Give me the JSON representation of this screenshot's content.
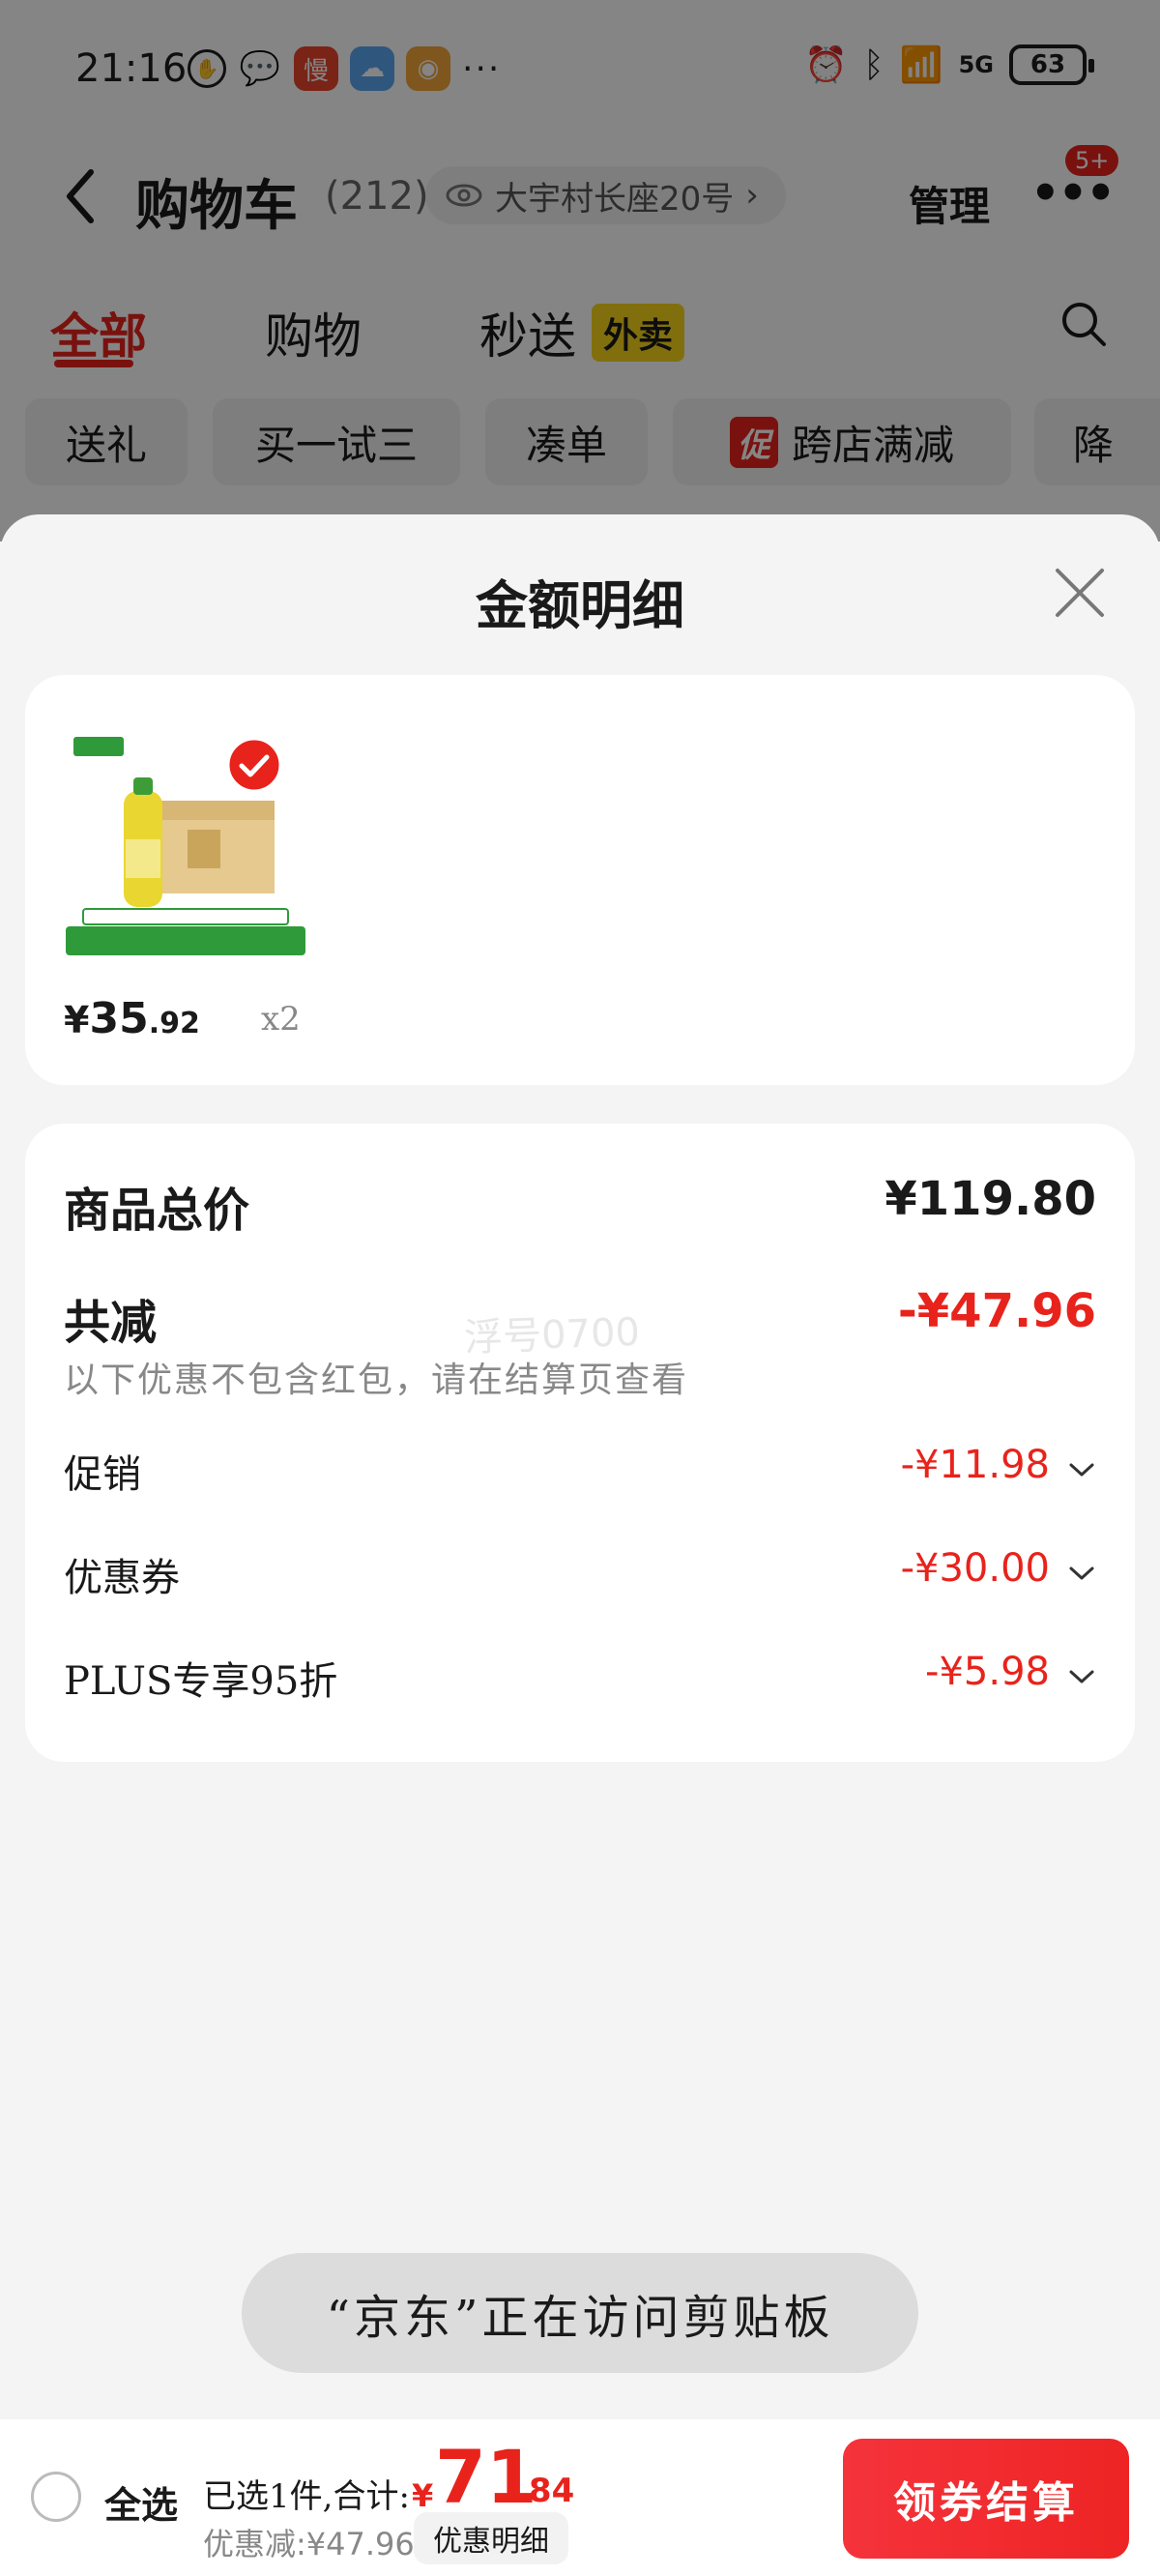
{
  "status_bar": {
    "time": "21:16",
    "left_icons": [
      "hand-icon",
      "wechat-icon",
      "slow-app-icon",
      "weather-icon",
      "orange-app-icon"
    ],
    "slow_app_glyph": "慢",
    "more": "···",
    "network": "5G",
    "battery": "63"
  },
  "cart_header": {
    "title": "购物车",
    "count": "(212)",
    "address": "大宇村长座20号",
    "address_chevron": "›",
    "manage": "管理",
    "more_badge": "5+"
  },
  "tabs": {
    "all": "全部",
    "shopping": "购物",
    "instant": "秒送",
    "takeout_tag": "外卖"
  },
  "chips": {
    "gift": "送礼",
    "try_three": "买一试三",
    "add_on": "凑单",
    "promo_tag": "促",
    "cross_store": "跨店满减",
    "price_drop": "降"
  },
  "sheet": {
    "title": "金额明细",
    "product": {
      "price_symbol": "¥",
      "price_int": "35",
      "price_dec": ".92",
      "quantity": "x2"
    },
    "total": {
      "label": "商品总价",
      "amount": "¥119.80"
    },
    "discount": {
      "label": "共减",
      "amount": "-¥47.96"
    },
    "note": "以下优惠不包含红包，请在结算页查看",
    "items": [
      {
        "label": "促销",
        "amount": "-¥11.98"
      },
      {
        "label": "优惠券",
        "amount": "-¥30.00"
      },
      {
        "label": "PLUS专享95折",
        "amount": "-¥5.98"
      }
    ],
    "watermark": "浮号0700"
  },
  "toast": "“京东”正在访问剪贴板",
  "bottom_bar": {
    "select_all": "全选",
    "selected_label": "已选1件,合计:",
    "total_symbol": "¥",
    "total_int": "71",
    "total_dec": ".84",
    "saved": "优惠减:¥47.96",
    "detail_button": "优惠明细",
    "checkout_button": "领券结算"
  },
  "colors": {
    "accent_red": "#e8231c",
    "takeout_yellow": "#f8d51c",
    "sheet_bg": "#f4f4f4"
  }
}
